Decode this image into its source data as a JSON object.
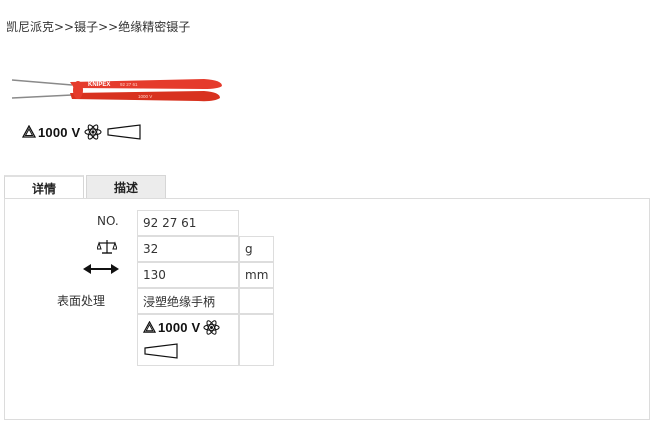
{
  "breadcrumb": "凯尼派克>>镊子>>绝缘精密镊子",
  "product": {
    "image_name": "insulated-precision-tweezers",
    "brand_print": "KNIPEX",
    "model_print": "92 27 61",
    "voltage_print": "1000 V"
  },
  "certification": {
    "voltage": "1000 V"
  },
  "tabs": [
    {
      "label": "详情"
    },
    {
      "label": "描述"
    }
  ],
  "specs": {
    "no_label": "NO.",
    "no_value": "92 27 61",
    "weight_icon": "scale-icon",
    "weight_value": "32",
    "weight_unit": "g",
    "length_icon": "length-arrow-icon",
    "length_value": "130",
    "length_unit": "mm",
    "finish_label": "表面处理",
    "finish_value": "浸塑绝缘手柄",
    "cert_voltage": "1000 V"
  },
  "colors": {
    "tool_red": "#e53b2c",
    "text": "#333333",
    "border": "#dddddd",
    "tab_bg": "#ececec"
  }
}
